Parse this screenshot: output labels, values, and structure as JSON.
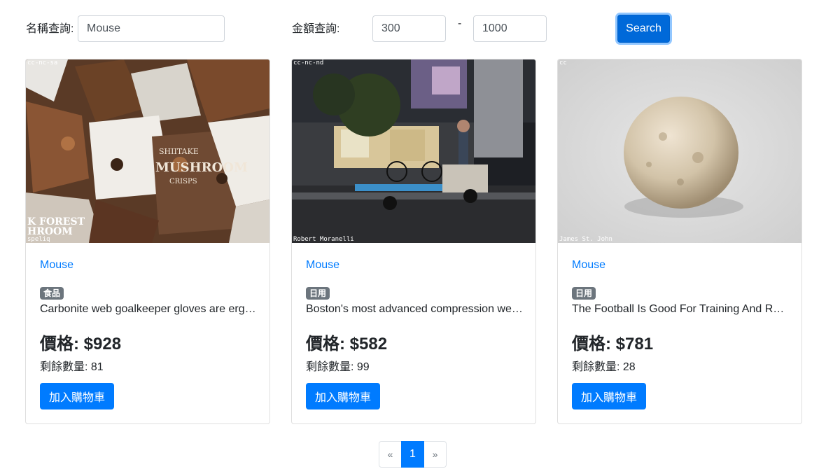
{
  "search": {
    "name_label": "名稱查詢:",
    "name_value": "Mouse",
    "amount_label": "金額查詢:",
    "min_value": "300",
    "range_separator": "-",
    "max_value": "1000",
    "button_label": "Search"
  },
  "products": [
    {
      "title": "Mouse",
      "category": "食品",
      "description": "Carbonite web goalkeeper gloves are ergonomically designed to give easy fit",
      "price": "價格: $928",
      "stock": "剩餘數量: 81",
      "button": "加入購物車",
      "image_credit_top": "cc-nc-sa",
      "image_credit_bottom": "speliq",
      "image_text_1": "MUSHROOM",
      "image_text_2": "CRISPS",
      "image_text_3": "SHIITAKE",
      "image_text_4": "K FOREST",
      "image_text_5": "HROOM"
    },
    {
      "title": "Mouse",
      "category": "日用",
      "description": "Boston's most advanced compression wear technology increases muscle oxygenation",
      "price": "價格: $582",
      "stock": "剩餘數量: 99",
      "button": "加入購物車",
      "image_credit_top": "cc-nc-nd",
      "image_credit_bottom": "Robert Moranelli"
    },
    {
      "title": "Mouse",
      "category": "日用",
      "description": "The Football Is Good For Training And Recreational Purposes",
      "price": "價格: $781",
      "stock": "剩餘數量: 28",
      "button": "加入購物車",
      "image_credit_top": "cc",
      "image_credit_bottom": "James St. John"
    }
  ],
  "pagination": {
    "prev": "«",
    "current": "1",
    "next": "»"
  },
  "colors": {
    "primary": "#007bff",
    "badge": "#6c757d",
    "search_button": "#0069d9"
  }
}
